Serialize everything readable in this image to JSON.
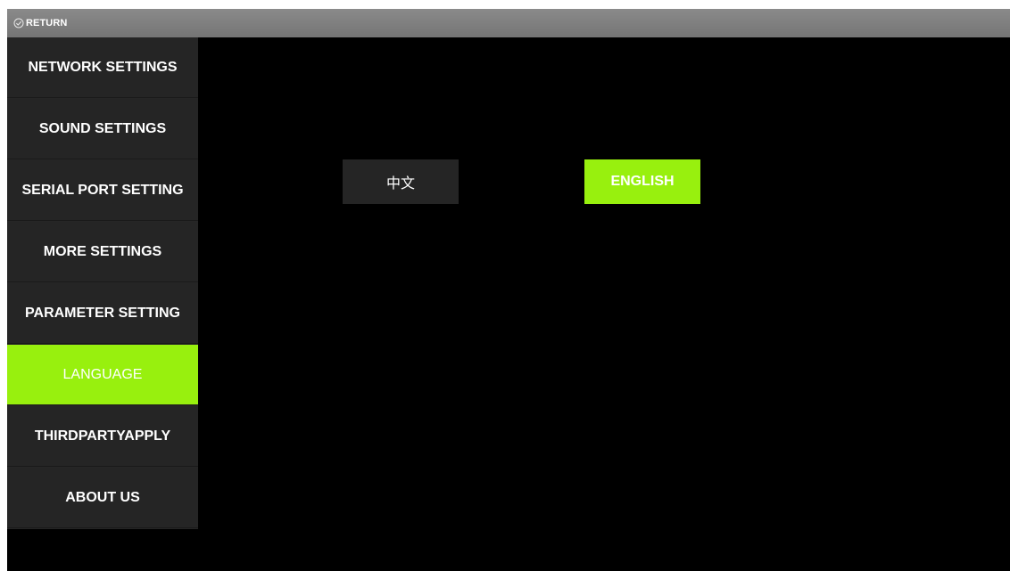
{
  "topbar": {
    "return_label": "RETURN",
    "return_icon": "check-circle-icon"
  },
  "sidebar": {
    "items": [
      {
        "label": "NETWORK SETTINGS",
        "active": false
      },
      {
        "label": "SOUND SETTINGS",
        "active": false
      },
      {
        "label": "SERIAL PORT SETTING",
        "active": false
      },
      {
        "label": "MORE SETTINGS",
        "active": false
      },
      {
        "label": "PARAMETER SETTING",
        "active": false
      },
      {
        "label": "LANGUAGE",
        "active": true
      },
      {
        "label": "THIRDPARTYAPPLY",
        "active": false
      },
      {
        "label": "ABOUT US",
        "active": false
      }
    ]
  },
  "language": {
    "options": [
      {
        "label": "中文",
        "selected": false
      },
      {
        "label": "ENGLISH",
        "selected": true
      }
    ]
  },
  "colors": {
    "accent": "#98f00e",
    "panel": "#252525",
    "background": "#000000",
    "topbar": "#808080"
  }
}
